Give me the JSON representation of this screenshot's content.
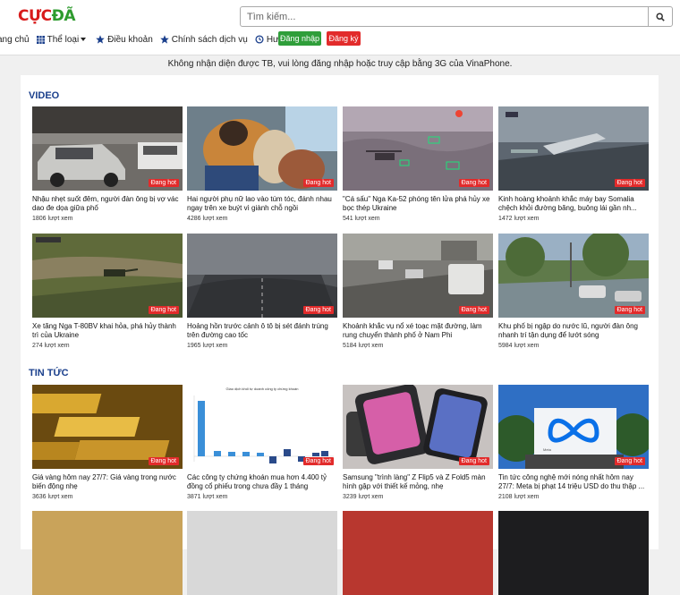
{
  "logo": {
    "part1": "CỰC",
    "part2": "ĐÃ"
  },
  "search": {
    "placeholder": "Tìm kiếm..."
  },
  "nav": {
    "items": [
      {
        "label": "ang chủ"
      },
      {
        "label": "Thể loại"
      },
      {
        "label": "Điều khoản"
      },
      {
        "label": "Chính sách dịch vụ"
      },
      {
        "label": "Hướng dẫn"
      }
    ],
    "login": "Đăng nhập",
    "register": "Đăng ký"
  },
  "notice": "Không nhận diện được TB, vui lòng đăng nhập hoặc truy cập bằng 3G của VinaPhone.",
  "badge": "Đang hot",
  "sections": [
    {
      "title": "VIDEO",
      "items": [
        {
          "title": "Nhậu nhẹt suốt đêm, người đàn ông bị vợ vác dao đe dọa giữa phố",
          "views": "1806 lượt xem",
          "icon": "street-car-thumbnail"
        },
        {
          "title": "Hai người phụ nữ lao vào túm tóc, đánh nhau ngay trên xe buýt vì giành chỗ ngồi",
          "views": "4286 lượt xem",
          "icon": "bus-fight-thumbnail"
        },
        {
          "title": "\"Cá sấu\" Nga Ka-52 phóng tên lửa phá hủy xe bọc thép Ukraine",
          "views": "541 lượt xem",
          "icon": "helicopter-thumbnail"
        },
        {
          "title": "Kinh hoàng khoảnh khắc máy bay Somalia chệch khỏi đường băng, buông lái gần nh...",
          "views": "1472 lượt xem",
          "icon": "airplane-thumbnail"
        },
        {
          "title": "Xe tăng Nga T-80BV khai hỏa, phá hủy thành trì của Ukraine",
          "views": "274 lượt xem",
          "icon": "tank-thumbnail"
        },
        {
          "title": "Hoảng hồn trước cảnh ô tô bị sét đánh trúng trên đường cao tốc",
          "views": "1965 lượt xem",
          "icon": "lightning-road-thumbnail"
        },
        {
          "title": "Khoảnh khắc vụ nổ xé toạc mặt đường, làm rung chuyển thành phố ở Nam Phi",
          "views": "5184 lượt xem",
          "icon": "explosion-road-thumbnail"
        },
        {
          "title": "Khu phố bị ngập do nước lũ, người đàn ông nhanh trí tận dụng để lướt sóng",
          "views": "5984 lượt xem",
          "icon": "flood-thumbnail"
        }
      ]
    },
    {
      "title": "TIN TỨC",
      "items": [
        {
          "title": "Giá vàng hôm nay 27/7: Giá vàng trong nước biến động nhẹ",
          "views": "3636 lượt xem",
          "icon": "gold-bars-thumbnail"
        },
        {
          "title": "Các công ty chứng khoán mua hơn 4.400 tỷ đồng cổ phiếu trong chưa đầy 1 tháng",
          "views": "3871 lượt xem",
          "icon": "bar-chart-thumbnail",
          "thumb_text": "Giao dịch khối tự doanh công ty chứng khoán"
        },
        {
          "title": "Samsung \"trình làng\" Z Flip5 và Z Fold5 màn hình gập với thiết kế mỏng, nhẹ",
          "views": "3239 lượt xem",
          "icon": "foldable-phone-thumbnail"
        },
        {
          "title": "Tin tức công nghệ mới nóng nhất hôm nay 27/7: Meta bị phạt 14 triệu USD do thu thập ...",
          "views": "2108 lượt xem",
          "icon": "meta-sign-thumbnail",
          "thumb_text": "Meta"
        }
      ]
    }
  ],
  "colors": {
    "brand_red": "#d81b1b",
    "brand_green": "#2e9b2e",
    "section_title": "#1a3f8c",
    "hot_badge": "#e22b2b",
    "login_btn": "#2f9e3a",
    "register_btn": "#e22b2b"
  }
}
